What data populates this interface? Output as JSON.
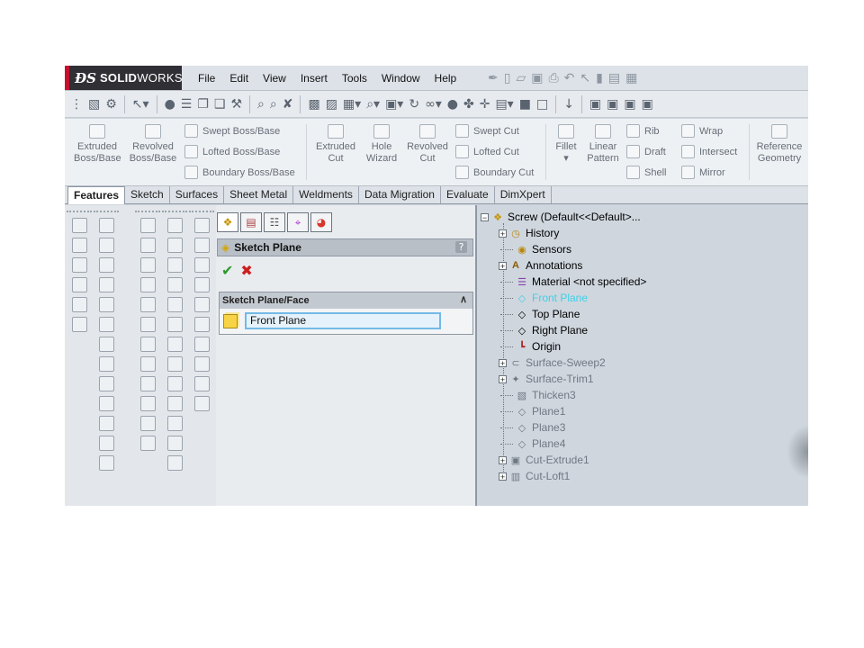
{
  "app": {
    "logo_ds": "ĐS",
    "logo_brand_bold": "SOLID",
    "logo_brand_rest": "WORKS"
  },
  "menu": [
    "File",
    "Edit",
    "View",
    "Insert",
    "Tools",
    "Window",
    "Help"
  ],
  "ribbon": {
    "extruded_boss": [
      "Extruded",
      "Boss/Base"
    ],
    "revolved_boss": [
      "Revolved",
      "Boss/Base"
    ],
    "swept_boss": "Swept Boss/Base",
    "lofted_boss": "Lofted Boss/Base",
    "boundary_boss": "Boundary Boss/Base",
    "extruded_cut": [
      "Extruded",
      "Cut"
    ],
    "hole_wizard": [
      "Hole",
      "Wizard"
    ],
    "revolved_cut": [
      "Revolved",
      "Cut"
    ],
    "swept_cut": "Swept Cut",
    "lofted_cut": "Lofted Cut",
    "boundary_cut": "Boundary Cut",
    "fillet": "Fillet",
    "linear_pattern": [
      "Linear",
      "Pattern"
    ],
    "rib": "Rib",
    "draft": "Draft",
    "shell": "Shell",
    "wrap": "Wrap",
    "intersect": "Intersect",
    "mirror": "Mirror",
    "reference_geometry": [
      "Reference",
      "Geometry"
    ]
  },
  "tabs": [
    "Features",
    "Sketch",
    "Surfaces",
    "Sheet Metal",
    "Weldments",
    "Data Migration",
    "Evaluate",
    "DimXpert"
  ],
  "property_manager": {
    "title": "Sketch Plane",
    "help": "?",
    "ok": "✔",
    "cancel": "✖",
    "group_title": "Sketch Plane/Face",
    "face_value": "Front Plane"
  },
  "tree": {
    "root": "Screw  (Default<<Default>...",
    "items": [
      {
        "label": "History"
      },
      {
        "label": "Sensors"
      },
      {
        "label": "Annotations"
      },
      {
        "label": "Material <not specified>"
      },
      {
        "label": "Front Plane"
      },
      {
        "label": "Top Plane"
      },
      {
        "label": "Right Plane"
      },
      {
        "label": "Origin"
      },
      {
        "label": "Surface-Sweep2"
      },
      {
        "label": "Surface-Trim1"
      },
      {
        "label": "Thicken3"
      },
      {
        "label": "Plane1"
      },
      {
        "label": "Plane3"
      },
      {
        "label": "Plane4"
      },
      {
        "label": "Cut-Extrude1"
      },
      {
        "label": "Cut-Loft1"
      }
    ]
  },
  "colors": {
    "selected": "#3fd0e8",
    "logo_red": "#c8102e",
    "check_green": "#2e9b2e",
    "cross_red": "#cc1f1f"
  }
}
